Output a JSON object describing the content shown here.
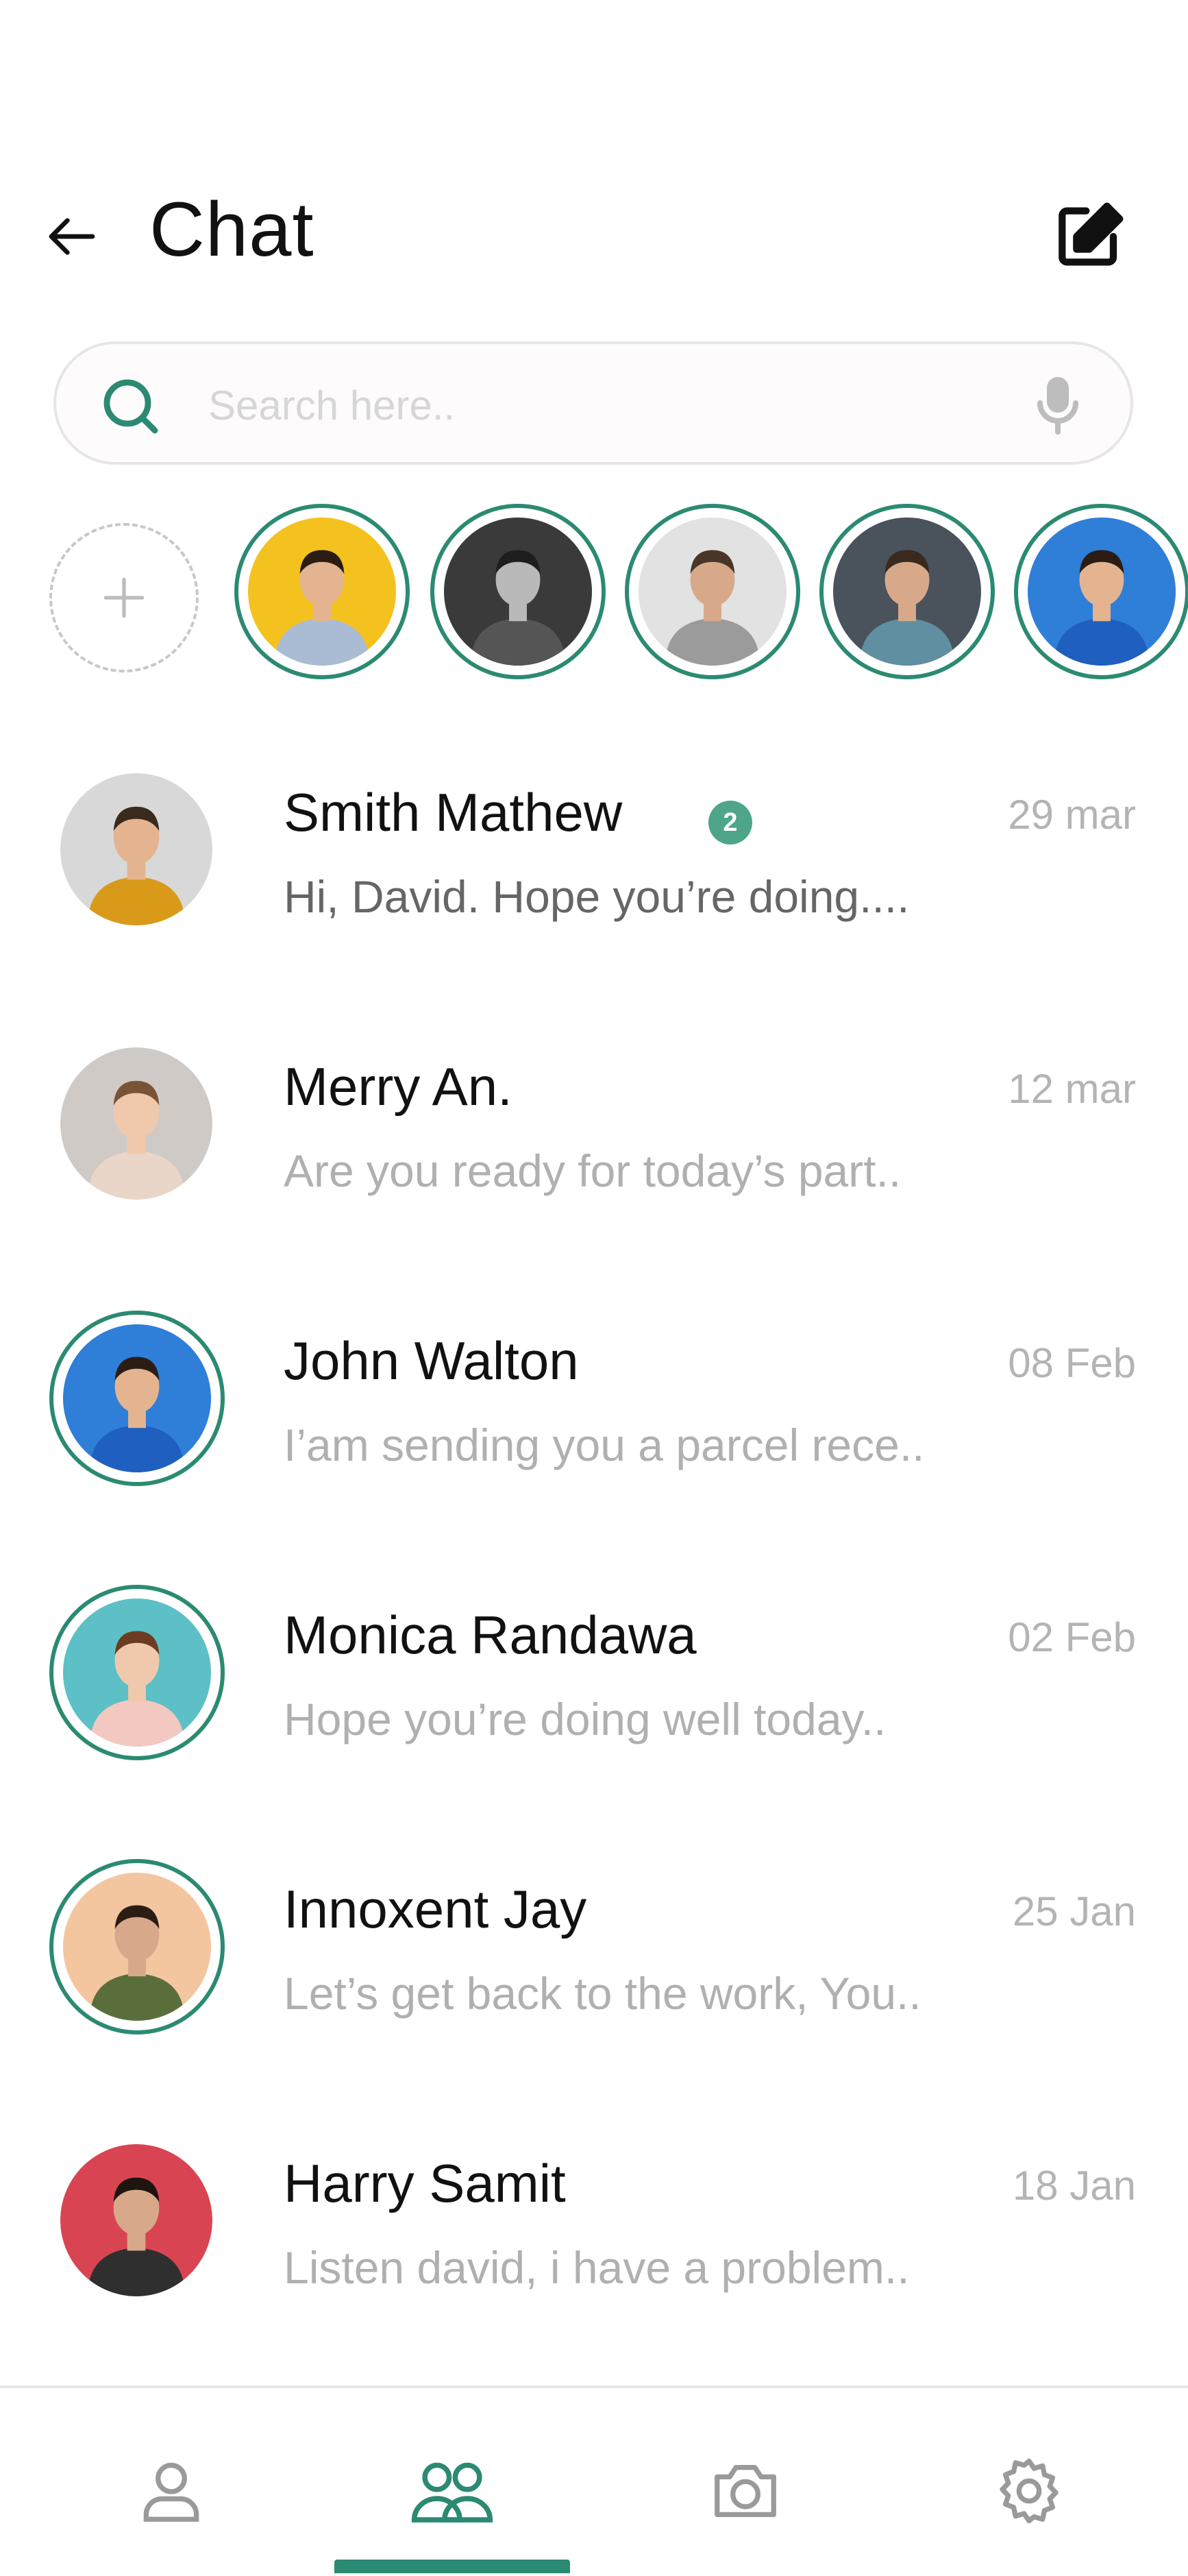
{
  "header": {
    "title": "Chat",
    "back_icon": "arrow-left-icon",
    "compose_icon": "compose-icon"
  },
  "search": {
    "placeholder": "Search here..",
    "value": "",
    "icon": "search-icon",
    "mic_icon": "microphone-icon"
  },
  "stories": {
    "add_icon": "plus-icon",
    "items": [
      {
        "bg": "#f4c21f",
        "shirt": "#a9bcd4",
        "skin": "#e3b48f",
        "hair": "#2b1d14"
      },
      {
        "bg": "#3a3a3a",
        "shirt": "#555555",
        "skin": "#b9b9b9",
        "hair": "#1e1e1e"
      },
      {
        "bg": "#e2e2e2",
        "shirt": "#9b9b9b",
        "skin": "#d7a98a",
        "hair": "#4a3628"
      },
      {
        "bg": "#4a525c",
        "shirt": "#5f8fa0",
        "skin": "#d7a98a",
        "hair": "#3a2a1e"
      },
      {
        "bg": "#2f7ed8",
        "shirt": "#1f5fbf",
        "skin": "#e3b48f",
        "hair": "#2b1d14"
      }
    ]
  },
  "chats": [
    {
      "name": "Smith Mathew",
      "preview": "Hi, David. Hope you’re doing....",
      "date": "29 mar",
      "badge": "2",
      "unread": true,
      "ring": false,
      "bg": "#d8d8d8",
      "shirt": "#d99a1a",
      "skin": "#e3b48f",
      "hair": "#3a2a1e"
    },
    {
      "name": "Merry An.",
      "preview": "Are you ready for today’s part..",
      "date": "12 mar",
      "unread": false,
      "ring": false,
      "bg": "#cfcac6",
      "shirt": "#e9d6c8",
      "skin": "#f0c9ad",
      "hair": "#7a5236"
    },
    {
      "name": "John Walton",
      "preview": "I’am sending you a parcel rece..",
      "date": "08 Feb",
      "unread": false,
      "ring": true,
      "bg": "#2f7ed8",
      "shirt": "#1f5fbf",
      "skin": "#e3b48f",
      "hair": "#2b1d14"
    },
    {
      "name": "Monica Randawa",
      "preview": "Hope you’re doing well today..",
      "date": "02 Feb",
      "unread": false,
      "ring": true,
      "bg": "#5cc0c6",
      "shirt": "#f3c8c0",
      "skin": "#f0c9ad",
      "hair": "#6b3c22"
    },
    {
      "name": "Innoxent Jay",
      "preview": "Let’s get back to the work, You..",
      "date": "25 Jan",
      "unread": false,
      "ring": true,
      "bg": "#f3c6a0",
      "shirt": "#5a6e3c",
      "skin": "#d7a98a",
      "hair": "#2b1d14"
    },
    {
      "name": "Harry Samit",
      "preview": "Listen david, i have a problem..",
      "date": "18 Jan",
      "unread": false,
      "ring": false,
      "bg": "#d94452",
      "shirt": "#2f2f2f",
      "skin": "#d7a98a",
      "hair": "#1e1510"
    }
  ],
  "nav": {
    "items": [
      {
        "icon": "profile-icon",
        "active": false
      },
      {
        "icon": "group-icon",
        "active": true
      },
      {
        "icon": "camera-icon",
        "active": false
      },
      {
        "icon": "settings-icon",
        "active": false
      }
    ]
  },
  "colors": {
    "accent": "#2b8a72",
    "badge": "#4ea58a",
    "muted_text": "#b0b0b0",
    "unread_text": "#666666"
  }
}
